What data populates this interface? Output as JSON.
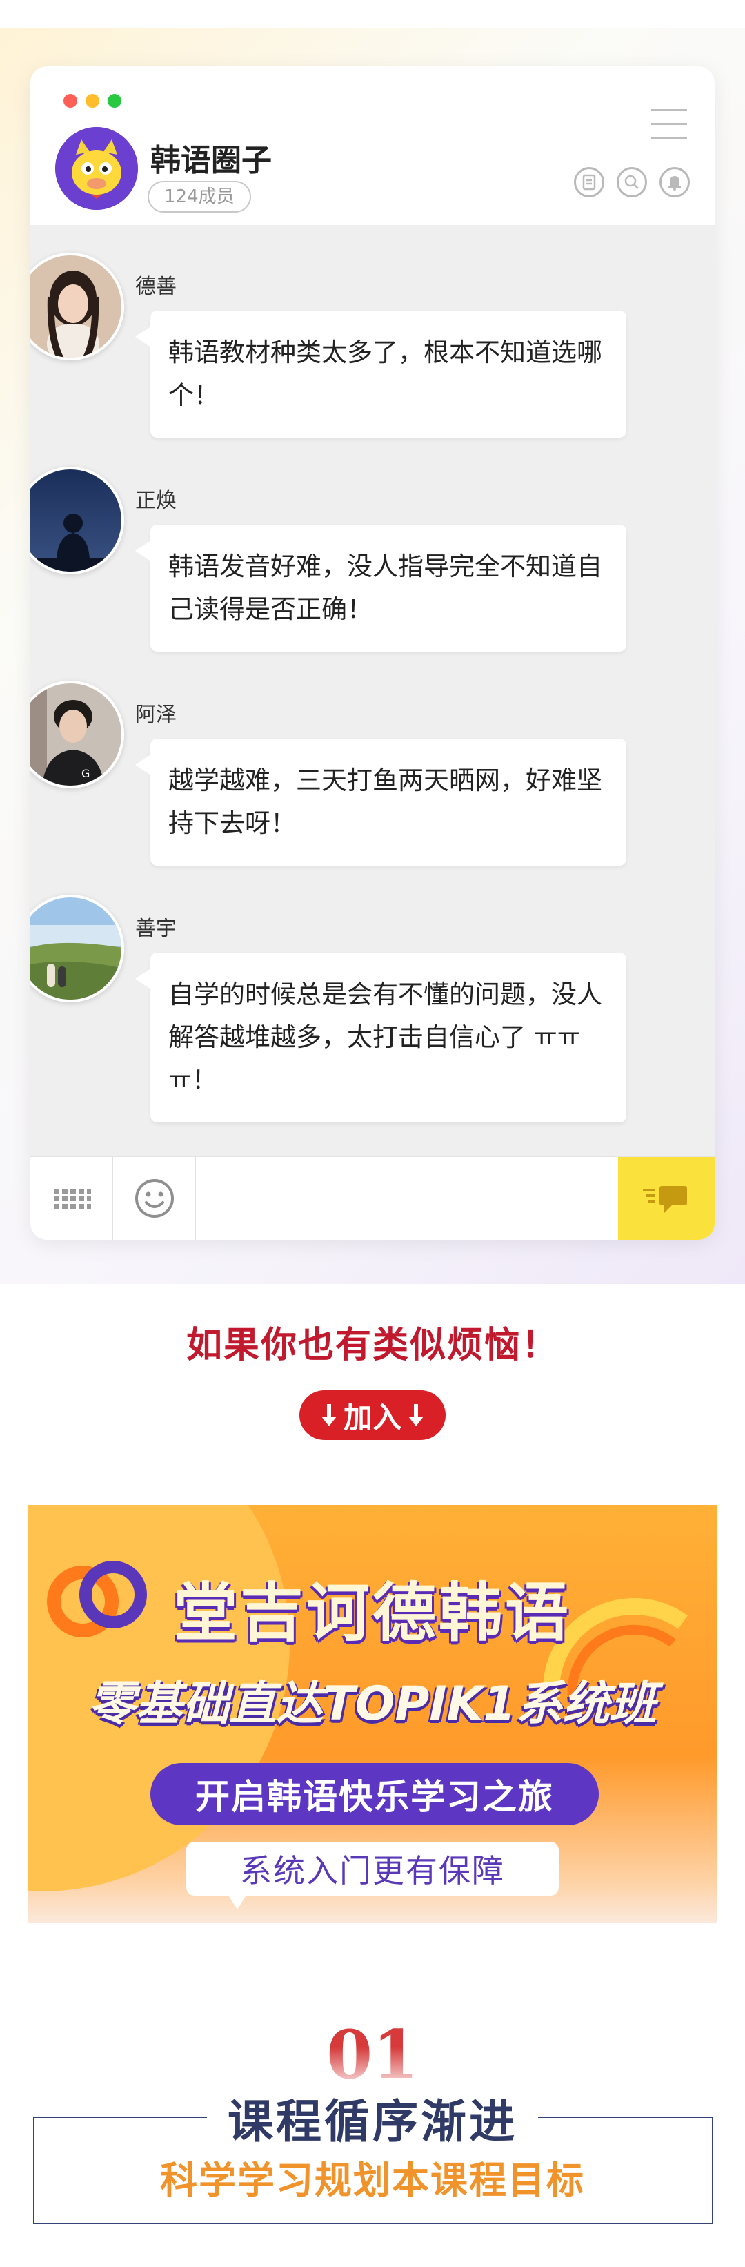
{
  "chat": {
    "group_title": "韩语圈子",
    "member_count": "124成员",
    "messages": [
      {
        "name": "德善",
        "text": "韩语教材种类太多了，根本不知道选哪个！"
      },
      {
        "name": "正焕",
        "text": "韩语发音好难，没人指导完全不知道自己读得是否正确！"
      },
      {
        "name": "阿泽",
        "text": "越学越难，三天打鱼两天晒网，好难坚持下去呀！"
      },
      {
        "name": "善宇",
        "text": "自学的时候总是会有不懂的问题，没人解答越堆越多，太打击自信心了 ㅠㅠㅠ！"
      }
    ],
    "icons": [
      "menu-icon",
      "document-icon",
      "search-icon",
      "bell-icon",
      "keyboard-icon",
      "emoji-icon",
      "send-icon"
    ]
  },
  "callout": {
    "headline": "如果你也有类似烦恼！",
    "join_label": "加入"
  },
  "banner": {
    "title": "堂吉诃德韩语",
    "subtitle": "零基础直达TOPIK1系统班",
    "pill": "开启韩语快乐学习之旅",
    "note": "系统入门更有保障"
  },
  "section": {
    "number": "01",
    "title": "课程循序渐进",
    "subtitle": "科学学习规划本课程目标"
  },
  "colors": {
    "accent_red": "#c1192d",
    "send_yellow": "#fae13b",
    "banner_orange": "#ff9a2b",
    "banner_purple": "#5d36c4",
    "section_blue": "#303a66",
    "section_orange": "#f0932b"
  }
}
